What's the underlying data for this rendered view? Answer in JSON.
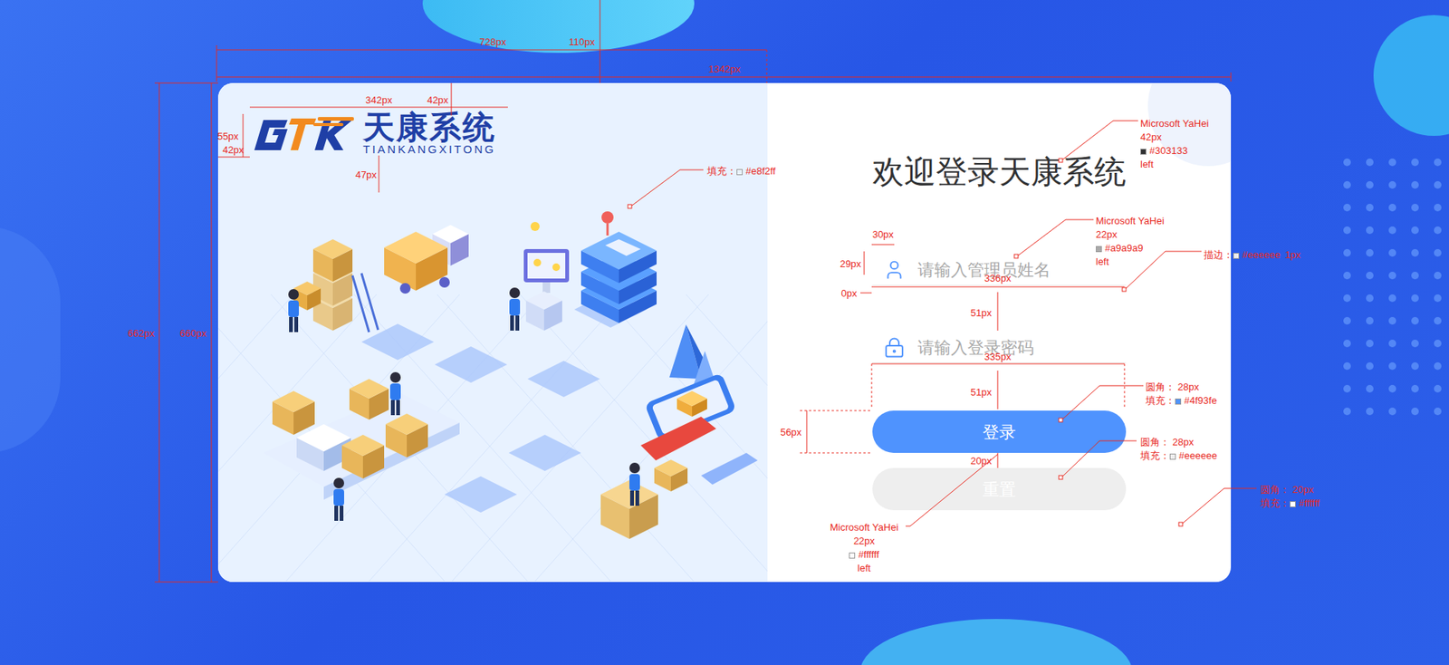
{
  "logo": {
    "name": "天康系统",
    "subtitle": "TIANKANGXITONG"
  },
  "login": {
    "title": "欢迎登录天康系统",
    "fields": [
      {
        "placeholder": "请输入管理员姓名",
        "kind": "user"
      },
      {
        "placeholder": "请输入登录密码",
        "kind": "password"
      }
    ],
    "buttons": [
      {
        "label": "登录",
        "kind": "primary"
      },
      {
        "label": "重置",
        "kind": "secondary"
      }
    ]
  },
  "annotations": {
    "dimensions": [
      "728px",
      "110px",
      "1342px",
      "342px",
      "42px",
      "55px",
      "42px",
      "47px",
      "662px",
      "660px",
      "30px",
      "29px",
      "336px",
      "0px",
      "51px",
      "335px",
      "51px",
      "56px",
      "20px"
    ],
    "notes": [
      {
        "kind": "font",
        "font": "Microsoft YaHei",
        "size": "42px",
        "color": "#303133",
        "align": "left"
      },
      {
        "kind": "font",
        "font": "Microsoft YaHei",
        "size": "22px",
        "color": "#a9a9a9",
        "align": "left"
      },
      {
        "kind": "stroke",
        "label": "描边：",
        "color": "#eeeeee",
        "width": "1px"
      },
      {
        "kind": "fill",
        "label": "填充：",
        "color": "#e8f2ff"
      },
      {
        "kind": "shape",
        "radius": "圆角： 28px",
        "label": "填充：",
        "color": "#4f93fe"
      },
      {
        "kind": "shape",
        "radius": "圆角： 28px",
        "label": "填充：",
        "color": "#eeeeee"
      },
      {
        "kind": "shape",
        "radius": "圆角： 20px",
        "label": "填充：",
        "color": "#ffffff"
      },
      {
        "kind": "font",
        "font": "Microsoft YaHei",
        "size": "22px",
        "color": "#ffffff",
        "align": "left"
      }
    ]
  }
}
